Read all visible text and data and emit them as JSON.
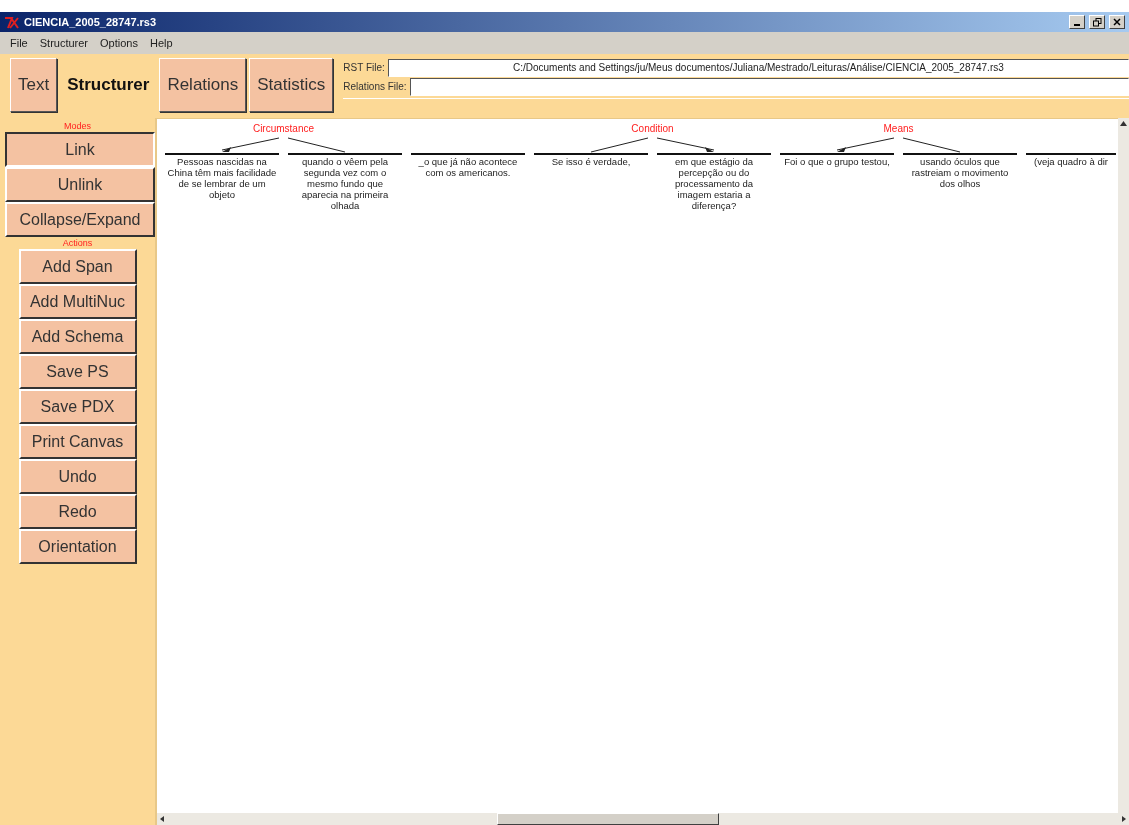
{
  "window": {
    "title": "CIENCIA_2005_28747.rs3"
  },
  "menu": [
    "File",
    "Structurer",
    "Options",
    "Help"
  ],
  "tabs": [
    {
      "label": "Text",
      "selected": false
    },
    {
      "label": "Structurer",
      "selected": true
    },
    {
      "label": "Relations",
      "selected": false
    },
    {
      "label": "Statistics",
      "selected": false
    }
  ],
  "files": [
    {
      "label": "RST File:",
      "value": "C:/Documents and Settings/ju/Meus documentos/Juliana/Mestrado/Leituras/Análise/CIENCIA_2005_28747.rs3"
    },
    {
      "label": "Relations File:"
    }
  ],
  "sidebar": {
    "modes_heading": "Modes",
    "modes": [
      {
        "label": "Link",
        "selected": true
      },
      {
        "label": "Unlink",
        "selected": false
      },
      {
        "label": "Collapse/Expand",
        "selected": false
      }
    ],
    "actions_heading": "Actions",
    "actions": [
      "Add Span",
      "Add MultiNuc",
      "Add Schema",
      "Save PS",
      "Save PDX",
      "Print Canvas",
      "Undo",
      "Redo",
      "Orientation"
    ]
  },
  "canvas": {
    "groups": [
      {
        "relation": "Circumstance",
        "segments": [
          {
            "text": "Pessoas nascidas na China têm mais facilidade de se lembrar de um objeto",
            "nucleus": true
          },
          {
            "text": "quando o vêem pela segunda vez com o mesmo fundo que aparecia na primeira olhada",
            "nucleus": false
          }
        ]
      },
      {
        "segments": [
          {
            "text": "_o que já não acontece com os americanos."
          }
        ]
      },
      {
        "relation": "Condition",
        "segments": [
          {
            "text": "Se isso é verdade,",
            "nucleus": false
          },
          {
            "text": "em que estágio da percepção ou do processamento da imagem estaria a diferença?",
            "nucleus": true
          }
        ]
      },
      {
        "relation": "Means",
        "segments": [
          {
            "text": "Foi o que o grupo testou,",
            "nucleus": true
          },
          {
            "text": "usando óculos que rastreiam o movimento dos olhos",
            "nucleus": false
          }
        ]
      },
      {
        "segments": [
          {
            "text": "(veja quadro à dir"
          }
        ]
      }
    ]
  }
}
